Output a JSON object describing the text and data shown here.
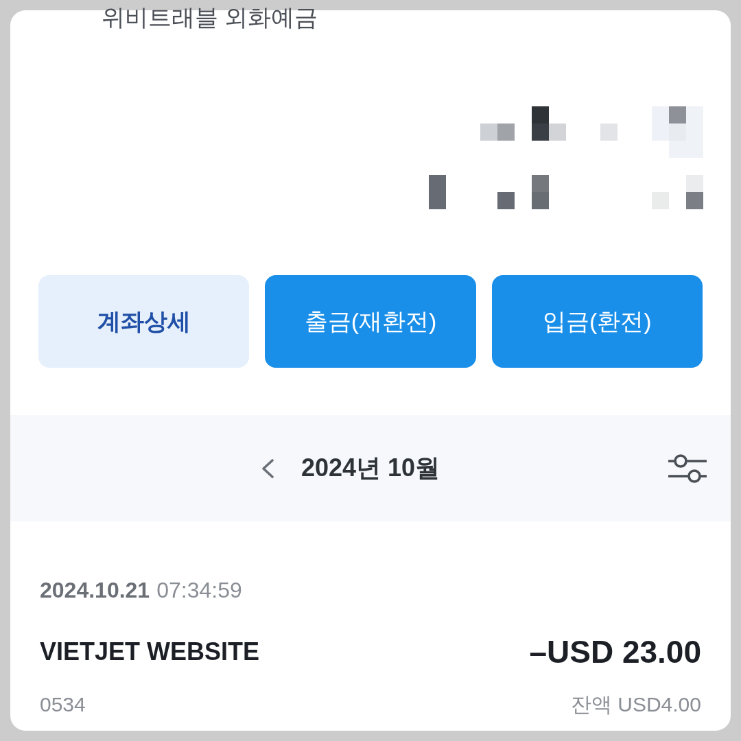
{
  "header": {
    "title": "위비트래블 외화예금"
  },
  "actions": [
    {
      "label": "계좌상세",
      "kind": "secondary"
    },
    {
      "label": "출금(재환전)",
      "kind": "primary"
    },
    {
      "label": "입금(환전)",
      "kind": "primary"
    }
  ],
  "month_bar": {
    "month": "2024년 10월"
  },
  "transactions": [
    {
      "date": "2024.10.21",
      "time": "07:34:59",
      "merchant": "VIETJET WEBSITE",
      "amount": "–USD 23.00",
      "card": "0534",
      "balance": "잔액 USD4.00"
    }
  ]
}
